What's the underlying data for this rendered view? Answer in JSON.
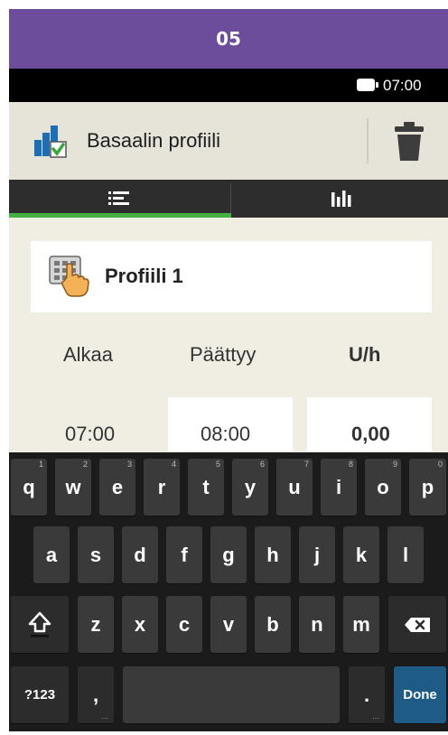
{
  "step_label": "05",
  "status": {
    "time": "07:00"
  },
  "header": {
    "title": "Basaalin profiili"
  },
  "tabs": [
    {
      "icon": "list-icon"
    },
    {
      "icon": "bar-chart-icon"
    }
  ],
  "profile": {
    "name": "Profiili 1"
  },
  "columns": {
    "start": "Alkaa",
    "end": "Päättyy",
    "rate": "U/h"
  },
  "row": {
    "start": "07:00",
    "end": "08:00",
    "rate": "0,00"
  },
  "keyboard": {
    "row1": [
      {
        "label": "q",
        "hint": "1"
      },
      {
        "label": "w",
        "hint": "2"
      },
      {
        "label": "e",
        "hint": "3"
      },
      {
        "label": "r",
        "hint": "4"
      },
      {
        "label": "t",
        "hint": "5"
      },
      {
        "label": "y",
        "hint": "6"
      },
      {
        "label": "u",
        "hint": "7"
      },
      {
        "label": "i",
        "hint": "8"
      },
      {
        "label": "o",
        "hint": "9"
      },
      {
        "label": "p",
        "hint": "0"
      }
    ],
    "row2": [
      "a",
      "s",
      "d",
      "f",
      "g",
      "h",
      "j",
      "k",
      "l"
    ],
    "row3": [
      "z",
      "x",
      "c",
      "v",
      "b",
      "n",
      "m"
    ],
    "symbols_label": "?123",
    "comma_label": ",",
    "period_label": ".",
    "done_label": "Done"
  },
  "colors": {
    "step_bar": "#6b4d9b",
    "tab_indicator": "#43b043",
    "done_key": "#1e5c86"
  }
}
